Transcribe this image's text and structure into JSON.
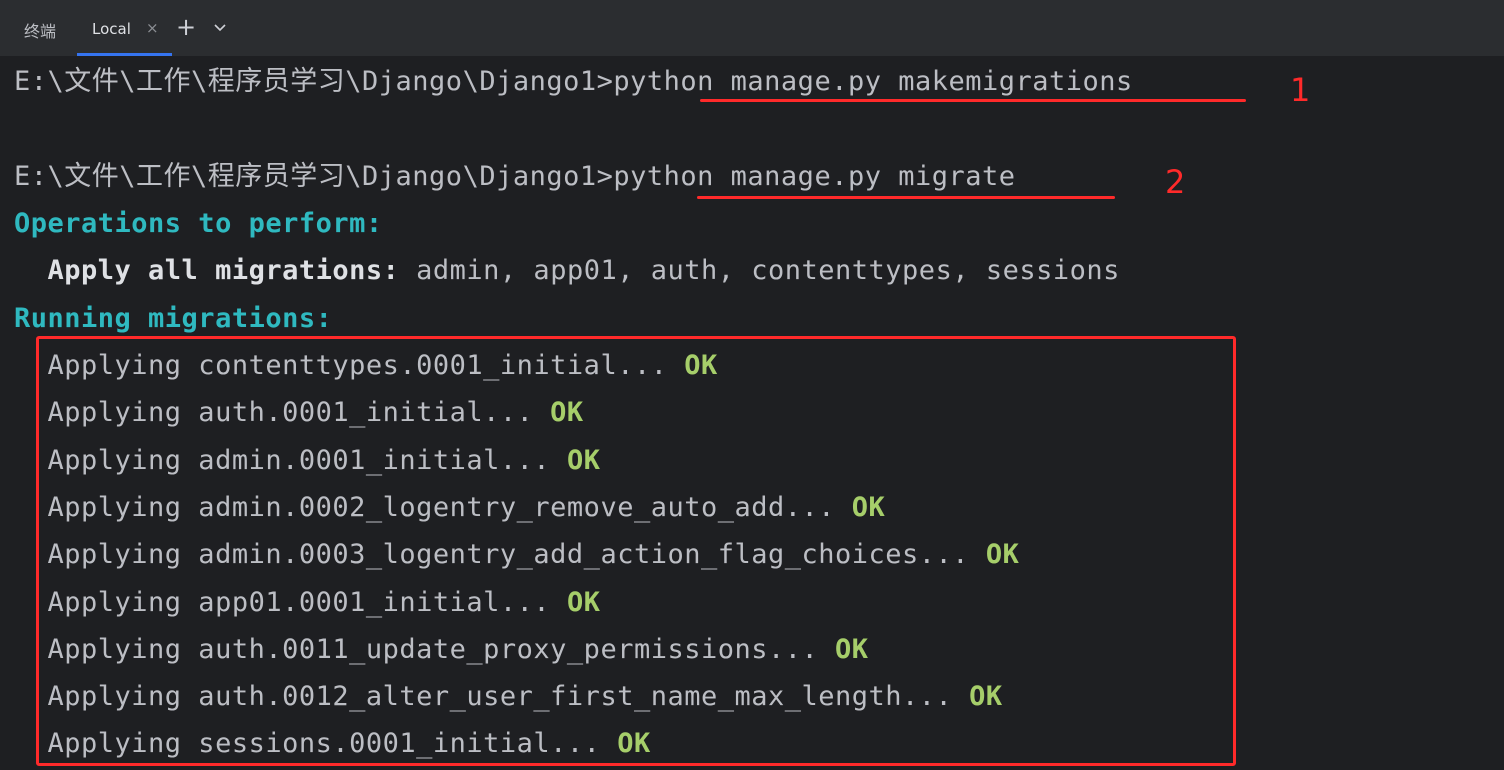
{
  "tabbar": {
    "title": "终端",
    "tab_label": "Local",
    "close_glyph": "×",
    "add_glyph": "+",
    "accent_color": "#3574f0"
  },
  "terminal": {
    "lines": [
      {
        "prompt": "E:\\文件\\工作\\程序员学习\\Django\\Django1>",
        "command": "python manage.py makemigrations"
      },
      {
        "prompt": "E:\\文件\\工作\\程序员学习\\Django\\Django1>",
        "command": "python manage.py migrate"
      }
    ],
    "ops_header": "Operations to perform:",
    "apply_all_label": "Apply all migrations:",
    "apply_all_value": " admin, app01, auth, contenttypes, sessions",
    "running_header": "Running migrations:",
    "migrations": [
      {
        "text": "  Applying contenttypes.0001_initial... ",
        "status": "OK"
      },
      {
        "text": "  Applying auth.0001_initial... ",
        "status": "OK"
      },
      {
        "text": "  Applying admin.0001_initial... ",
        "status": "OK"
      },
      {
        "text": "  Applying admin.0002_logentry_remove_auto_add... ",
        "status": "OK"
      },
      {
        "text": "  Applying admin.0003_logentry_add_action_flag_choices... ",
        "status": "OK"
      },
      {
        "text": "  Applying app01.0001_initial... ",
        "status": "OK"
      },
      {
        "text": "  Applying auth.0011_update_proxy_permissions... ",
        "status": "OK"
      },
      {
        "text": "  Applying auth.0012_alter_user_first_name_max_length... ",
        "status": "OK"
      },
      {
        "text": "  Applying sessions.0001_initial... ",
        "status": "OK"
      }
    ]
  },
  "annotations": {
    "marker1": "1",
    "marker2": "2",
    "color": "#ff2a2a"
  }
}
